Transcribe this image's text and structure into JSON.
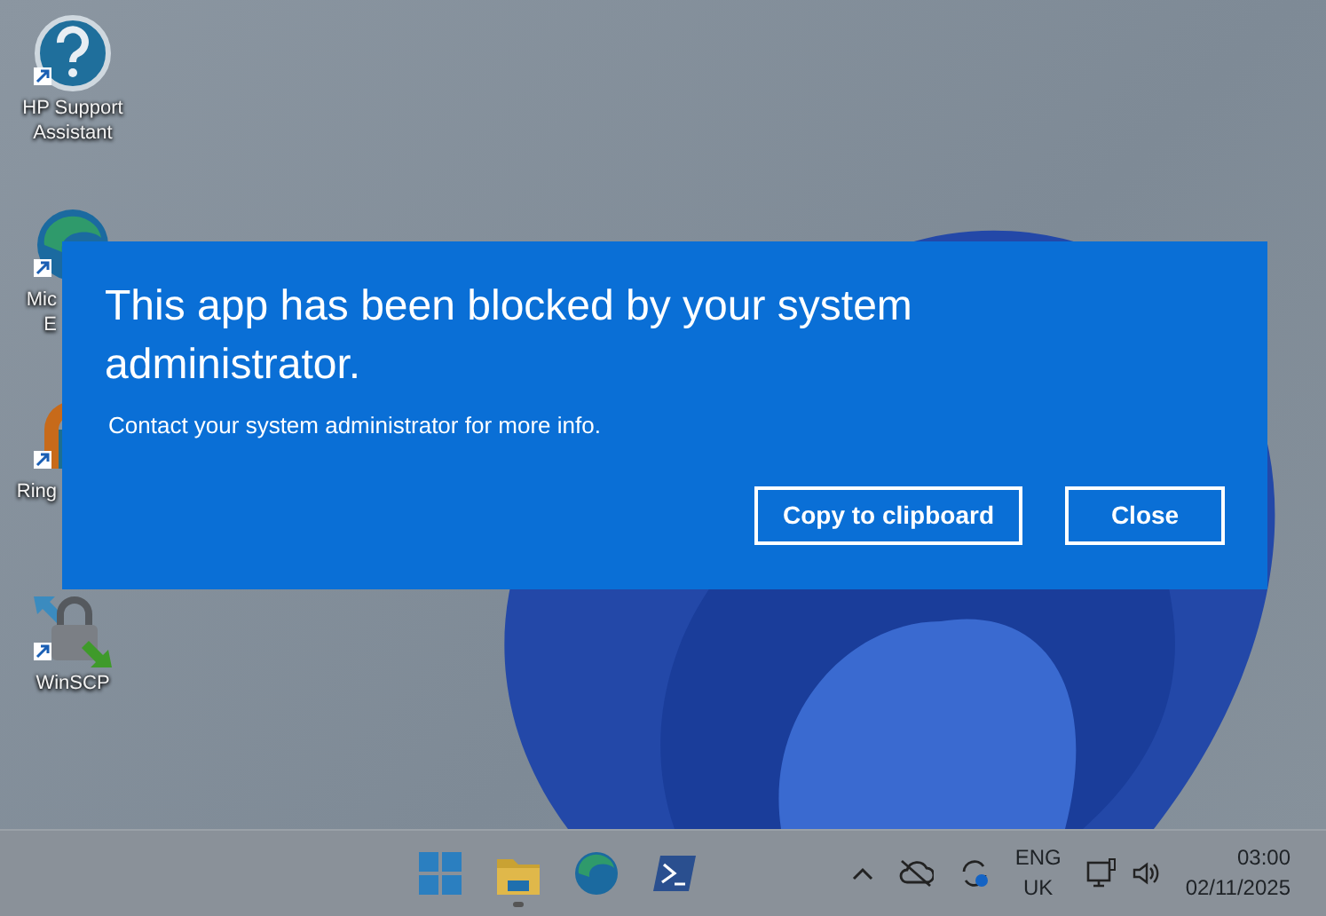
{
  "desktop_icons": [
    {
      "kind": "help",
      "lines": [
        "HP Support",
        "Assistant"
      ]
    },
    {
      "kind": "browser",
      "lines": [
        "Mic",
        "E"
      ]
    },
    {
      "kind": "ring",
      "lines": [
        "Ring"
      ]
    },
    {
      "kind": "lock",
      "lines": [
        "WinSCP"
      ]
    }
  ],
  "dialog": {
    "title": "This app has been blocked by your system administrator.",
    "message": "Contact your system administrator for more info.",
    "buttons": [
      "Copy to clipboard",
      "Close"
    ]
  },
  "taskbar": {
    "apps": [
      {
        "kind": "start",
        "running": false
      },
      {
        "kind": "folder",
        "running": true
      },
      {
        "kind": "browser",
        "running": false
      },
      {
        "kind": "terminal",
        "running": false
      }
    ],
    "tray": {
      "language": "ENG",
      "region": "UK",
      "time": "03:00",
      "date": "02/11/2025"
    }
  }
}
